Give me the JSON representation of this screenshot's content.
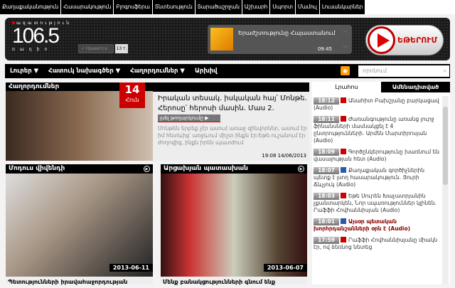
{
  "top_nav": [
    "Քաղաքականություն",
    "Հասարակություն",
    "Բլոգոսֆերա",
    "Տնտեսություն",
    "Տարածաշրջան",
    "Աշխարհ",
    "Սպորտ",
    "Մամուլ",
    "Լուսանկարներ"
  ],
  "header": {
    "logo_top": "ազատություն",
    "logo_num": "106.5",
    "logo_bottom": "ռադիո",
    "like_label": "✓ Нравится",
    "like_count": "13 т.",
    "player": {
      "title": "Երաժշտությունը Հայաստանում",
      "time": "09:45"
    },
    "live_label": "ԵԹԵՐՈՒՄ"
  },
  "main_nav": {
    "items": [
      "Լուրեր ▼",
      "Հատուկ նախագծեր ▼",
      "Հաղորդումներ ▼",
      "Արխիվ"
    ],
    "rss": "rss-icon",
    "search_placeholder": "որոնում"
  },
  "feature": {
    "section": "Հաղորդումներ",
    "day": "14",
    "month": "Հուն",
    "title": "Իրական տեսակ. իսկական հայ՝ Մոնթե. Հերոսը՝ հերոսի մասին. Մաս 2.",
    "listen": "լսել թողարկումը ▶",
    "desc": "Մոնթեն երբեք չէր ասում առաջ զինվորներ, ասում էր իմ հետևից՝ առջևում միշտ ինքն էր:Եթե ուշանում էր ժողովից, ինքն իրեն պատժում",
    "date": "19:08 14/06/2013"
  },
  "videos": [
    {
      "section": "Մոդուս վիվենդի",
      "date": "2013-06-11",
      "caption": "Պետությունների իրավահաջորդության"
    },
    {
      "section": "Արցախյան պատասխան",
      "date": "2013-06-07",
      "caption": "Մենք բանակցությունների գնում ենք"
    }
  ],
  "sidebar": {
    "tabs": [
      "Լրահոս",
      "Ամենադիտված"
    ],
    "news": [
      {
        "time": "18:12",
        "icon": "red",
        "text": "Անահիտ Բախշյանը բարկացավ (Audio)"
      },
      {
        "time": "18:11",
        "icon": "red",
        "text": "Ժառանգությունը առանց լուրջ ֆինանսների մասնակցել է 4 ընտրությունների. Արմեն Մարտիրոսյան (Audio)"
      },
      {
        "time": "18:09",
        "icon": "red",
        "text": "Գործընկերությունը խառնում են վասալության հետ (Audio)"
      },
      {
        "time": "18:07",
        "icon": "blue",
        "text": "Քաղաքական գործիչներին պետք է լսող հասարակություն. Յուրի Ճևչյուկ (Audio)"
      },
      {
        "time": "18:03",
        "icon": "red",
        "text": "Եթե Սուրեն Խաչատրյանին չքանտարկեն, Նոր սպառություններ կլինեն. Րաֆֆի Հովհաննիսյան (Audio)"
      },
      {
        "time": "18:01",
        "icon": "blue",
        "text": "Այսօր պետական խորհրդանշանների օրն է (Audio)",
        "bold": true
      },
      {
        "time": "17:59",
        "icon": "red",
        "text": "Րաֆֆի Հովհաննիսյանը միակն էր, ով ձեռնոց նետեց"
      }
    ]
  }
}
